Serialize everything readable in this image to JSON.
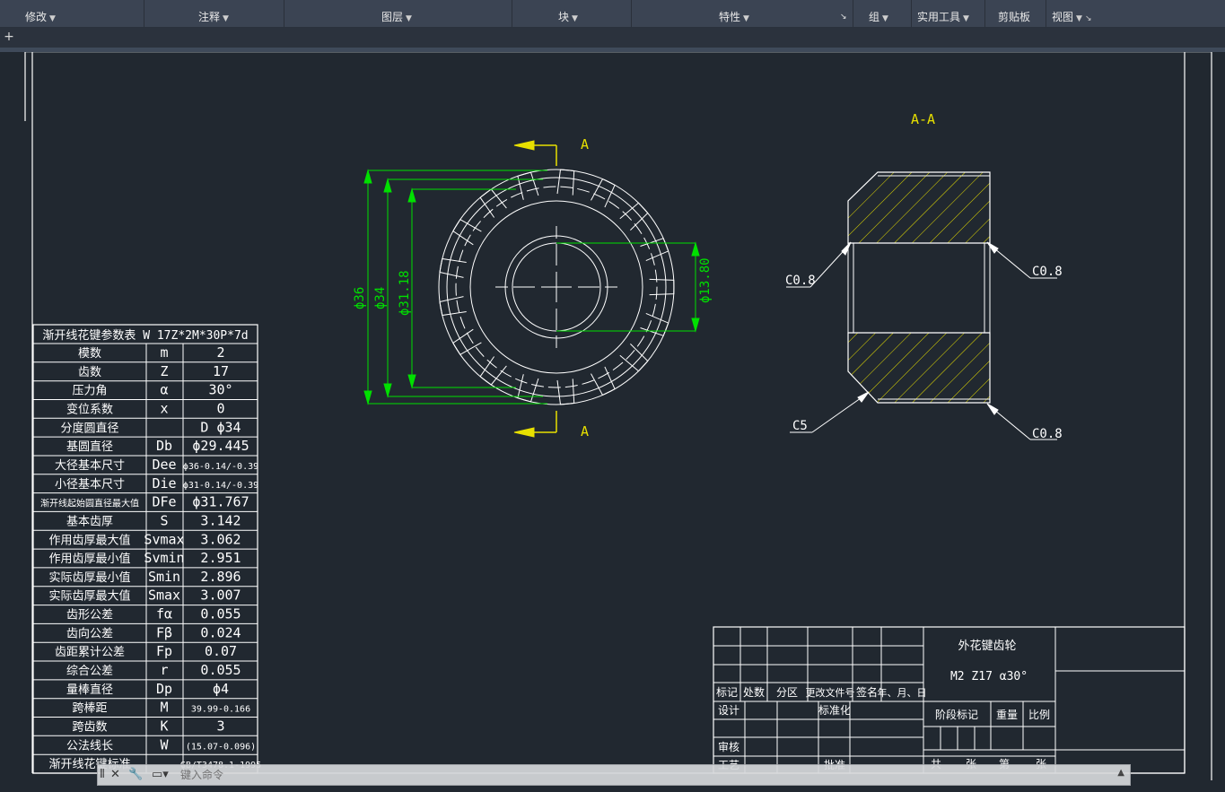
{
  "ribbon": {
    "panels": [
      "修改",
      "注释",
      "图层",
      "块",
      "特性",
      "组",
      "实用工具",
      "剪贴板",
      "视图"
    ]
  },
  "tabbar": {
    "add": "+"
  },
  "drawing": {
    "section_label": "A-A",
    "cut_label": "A",
    "dims": {
      "d36": "ϕ36",
      "d34": "ϕ34",
      "d3118": "ϕ31.18",
      "d1380": "ϕ13.80"
    },
    "chamfers": {
      "c08": "C0.8",
      "c5": "C5"
    }
  },
  "param_table": {
    "title": "渐开线花键参数表 W 17Z*2M*30P*7d",
    "rows": [
      [
        "模数",
        "m",
        "2"
      ],
      [
        "齿数",
        "Z",
        "17"
      ],
      [
        "压力角",
        "α",
        "30°"
      ],
      [
        "变位系数",
        "x",
        "0"
      ],
      [
        "分度圆直径",
        "",
        "D ϕ34"
      ],
      [
        "基圆直径",
        "Db",
        "ϕ29.445"
      ],
      [
        "大径基本尺寸",
        "Dee",
        "ϕ36-0.14/-0.39"
      ],
      [
        "小径基本尺寸",
        "Die",
        "ϕ31-0.14/-0.39"
      ],
      [
        "渐开线起始圆直径最大值",
        "DFe",
        "ϕ31.767"
      ],
      [
        "基本齿厚",
        "S",
        "3.142"
      ],
      [
        "作用齿厚最大值",
        "Svmax",
        "3.062"
      ],
      [
        "作用齿厚最小值",
        "Svmin",
        "2.951"
      ],
      [
        "实际齿厚最小值",
        "Smin",
        "2.896"
      ],
      [
        "实际齿厚最大值",
        "Smax",
        "3.007"
      ],
      [
        "齿形公差",
        "fα",
        "0.055"
      ],
      [
        "齿向公差",
        "Fβ",
        "0.024"
      ],
      [
        "齿距累计公差",
        "Fp",
        "0.07"
      ],
      [
        "综合公差",
        "r",
        "0.055"
      ],
      [
        "量棒直径",
        "Dp",
        "ϕ4"
      ],
      [
        "跨棒距",
        "M",
        "39.99-0.166"
      ],
      [
        "跨齿数",
        "K",
        "3"
      ],
      [
        "公法线长",
        "W",
        "(15.07-0.096)"
      ],
      [
        "渐开线花键标准",
        "",
        "GB/T3478.1-1995"
      ]
    ]
  },
  "title_block": {
    "part_name": "外花键齿轮",
    "spec": "M2 Z17 α30°",
    "headers": [
      "标记",
      "处数",
      "分区",
      "更改文件号",
      "签名",
      "年、月、日"
    ],
    "design": "设计",
    "standardize": "标准化",
    "review": "审核",
    "process": "工艺",
    "approve": "批准",
    "stage_mark": "阶段标记",
    "weight": "重量",
    "scale": "比例",
    "total": "共",
    "sheet": "张",
    "page": "第",
    "sheet2": "张"
  },
  "cmdline": {
    "placeholder": "键入命令"
  },
  "colors": {
    "green": "#00e000",
    "yellow": "#e8e000",
    "white": "#ffffff",
    "bg": "#212830"
  }
}
